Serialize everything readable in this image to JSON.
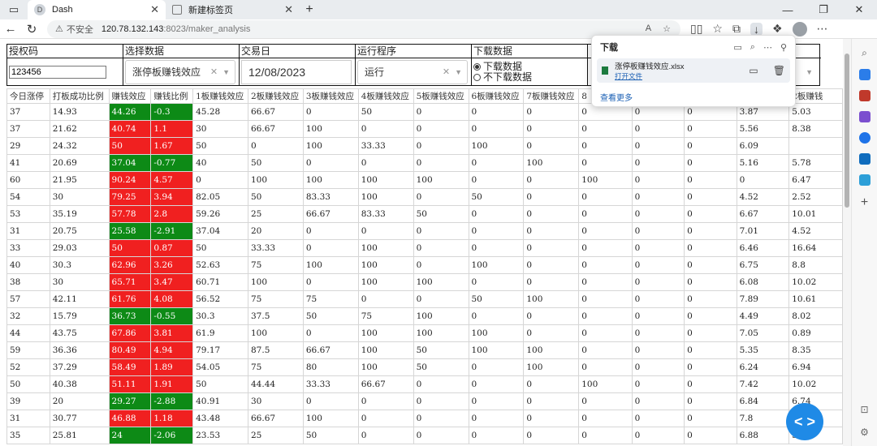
{
  "tabs": [
    {
      "title": "Dash",
      "icon": "D"
    },
    {
      "title": "新建标签页",
      "icon": ""
    }
  ],
  "window_controls": {
    "minimize": "—",
    "maximize": "❐",
    "close": "✕"
  },
  "address": {
    "insecure_label": "不安全",
    "host": "120.78.132.143",
    "path": ":8023/maker_analysis"
  },
  "filters": {
    "auth_code": {
      "label": "授权码",
      "value": "123456"
    },
    "select_data": {
      "label": "选择数据",
      "value": "涨停板赚钱效应"
    },
    "trade_date": {
      "label": "交易日",
      "value": "12/08/2023"
    },
    "run_program": {
      "label": "运行程序",
      "value": "运行"
    },
    "download": {
      "label": "下载数据",
      "option_on": "下载数据",
      "option_off": "不下载数据"
    }
  },
  "table": {
    "columns": [
      "今日涨停",
      "打板成功比例",
      "赚钱效应",
      "赚钱比例",
      "1板赚钱效应",
      "2板赚钱效应",
      "3板赚钱效应",
      "4板赚钱效应",
      "5板赚钱效应",
      "6板赚钱效应",
      "7板赚钱效应",
      "8",
      "",
      "",
      "例",
      "2板赚钱"
    ],
    "rows": [
      [
        "37",
        "14.93",
        "44.26",
        "-0.3",
        "45.28",
        "66.67",
        "0",
        "50",
        "0",
        "0",
        "0",
        "0",
        "0",
        "0",
        "3.87",
        "5.03"
      ],
      [
        "37",
        "21.62",
        "40.74",
        "1.1",
        "30",
        "66.67",
        "100",
        "0",
        "0",
        "0",
        "0",
        "0",
        "0",
        "0",
        "5.56",
        "8.38"
      ],
      [
        "29",
        "24.32",
        "50",
        "1.67",
        "50",
        "0",
        "100",
        "33.33",
        "0",
        "100",
        "0",
        "0",
        "0",
        "0",
        "6.09",
        ""
      ],
      [
        "41",
        "20.69",
        "37.04",
        "-0.77",
        "40",
        "50",
        "0",
        "0",
        "0",
        "0",
        "100",
        "0",
        "0",
        "0",
        "5.16",
        "5.78"
      ],
      [
        "60",
        "21.95",
        "90.24",
        "4.57",
        "0",
        "100",
        "100",
        "100",
        "100",
        "0",
        "0",
        "100",
        "0",
        "0",
        "0",
        "6.47"
      ],
      [
        "54",
        "30",
        "79.25",
        "3.94",
        "82.05",
        "50",
        "83.33",
        "100",
        "0",
        "50",
        "0",
        "0",
        "0",
        "0",
        "4.52",
        "2.52"
      ],
      [
        "53",
        "35.19",
        "57.78",
        "2.8",
        "59.26",
        "25",
        "66.67",
        "83.33",
        "50",
        "0",
        "0",
        "0",
        "0",
        "0",
        "6.67",
        "10.01"
      ],
      [
        "31",
        "20.75",
        "25.58",
        "-2.91",
        "37.04",
        "20",
        "0",
        "0",
        "0",
        "0",
        "0",
        "0",
        "0",
        "0",
        "7.01",
        "4.52"
      ],
      [
        "33",
        "29.03",
        "50",
        "0.87",
        "50",
        "33.33",
        "0",
        "100",
        "0",
        "0",
        "0",
        "0",
        "0",
        "0",
        "6.46",
        "16.64"
      ],
      [
        "40",
        "30.3",
        "62.96",
        "3.26",
        "52.63",
        "75",
        "100",
        "100",
        "0",
        "100",
        "0",
        "0",
        "0",
        "0",
        "6.75",
        "8.8"
      ],
      [
        "38",
        "30",
        "65.71",
        "3.47",
        "60.71",
        "100",
        "0",
        "100",
        "100",
        "0",
        "0",
        "0",
        "0",
        "0",
        "6.08",
        "10.02"
      ],
      [
        "57",
        "42.11",
        "61.76",
        "4.08",
        "56.52",
        "75",
        "75",
        "0",
        "0",
        "50",
        "100",
        "0",
        "0",
        "0",
        "7.89",
        "10.61"
      ],
      [
        "32",
        "15.79",
        "36.73",
        "-0.55",
        "30.3",
        "37.5",
        "50",
        "75",
        "100",
        "0",
        "0",
        "0",
        "0",
        "0",
        "4.49",
        "8.02"
      ],
      [
        "44",
        "43.75",
        "67.86",
        "3.81",
        "61.9",
        "100",
        "0",
        "100",
        "100",
        "100",
        "0",
        "0",
        "0",
        "0",
        "7.05",
        "0.89"
      ],
      [
        "59",
        "36.36",
        "80.49",
        "4.94",
        "79.17",
        "87.5",
        "66.67",
        "100",
        "50",
        "100",
        "100",
        "0",
        "0",
        "0",
        "5.35",
        "8.35"
      ],
      [
        "52",
        "37.29",
        "58.49",
        "1.89",
        "54.05",
        "75",
        "80",
        "100",
        "50",
        "0",
        "100",
        "0",
        "0",
        "0",
        "6.24",
        "6.94"
      ],
      [
        "50",
        "40.38",
        "51.11",
        "1.91",
        "50",
        "44.44",
        "33.33",
        "66.67",
        "0",
        "0",
        "0",
        "100",
        "0",
        "0",
        "7.42",
        "10.02"
      ],
      [
        "39",
        "20",
        "29.27",
        "-2.88",
        "40.91",
        "30",
        "0",
        "0",
        "0",
        "0",
        "0",
        "0",
        "0",
        "0",
        "6.84",
        "6.74"
      ],
      [
        "31",
        "30.77",
        "46.88",
        "1.18",
        "43.48",
        "66.67",
        "100",
        "0",
        "0",
        "0",
        "0",
        "0",
        "0",
        "0",
        "7.8",
        "3"
      ],
      [
        "35",
        "25.81",
        "24",
        "-2.06",
        "23.53",
        "25",
        "50",
        "0",
        "0",
        "0",
        "0",
        "0",
        "0",
        "0",
        "6.88",
        "5.96"
      ]
    ],
    "highlight_colors": {
      "positive": "#f02020",
      "negative": "#0d8a16"
    }
  },
  "downloads_panel": {
    "title": "下载",
    "file_name": "涨停板赚钱效应.xlsx",
    "open_label": "打开文件",
    "more_label": "查看更多"
  }
}
